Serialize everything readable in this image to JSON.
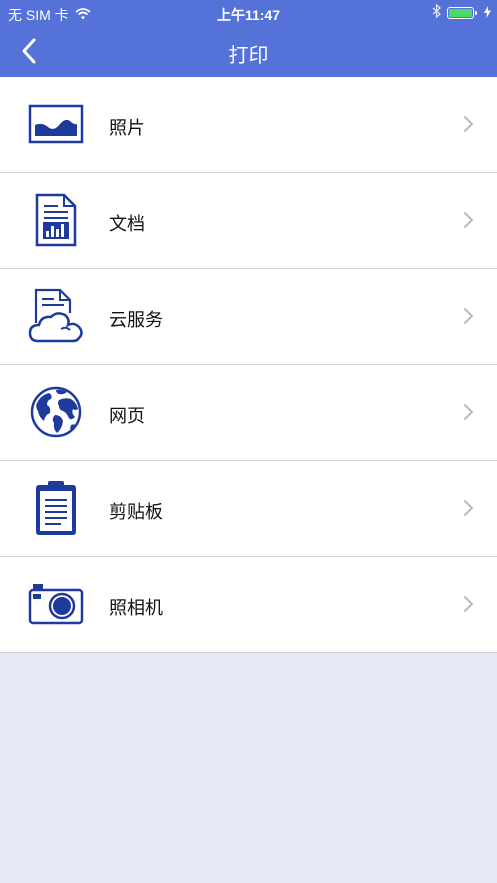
{
  "status_bar": {
    "carrier": "无 SIM 卡",
    "time": "上午11:47",
    "battery_color": "#4cd964"
  },
  "nav": {
    "title": "打印",
    "back_icon": "chevron-left-icon",
    "bar_color": "#5472d8"
  },
  "menu": {
    "items": [
      {
        "label": "照片",
        "icon": "photo-icon"
      },
      {
        "label": "文档",
        "icon": "document-icon"
      },
      {
        "label": "云服务",
        "icon": "cloud-document-icon"
      },
      {
        "label": "网页",
        "icon": "globe-icon"
      },
      {
        "label": "剪贴板",
        "icon": "clipboard-icon"
      },
      {
        "label": "照相机",
        "icon": "camera-icon"
      }
    ],
    "icon_color": "#1d3a9c"
  }
}
